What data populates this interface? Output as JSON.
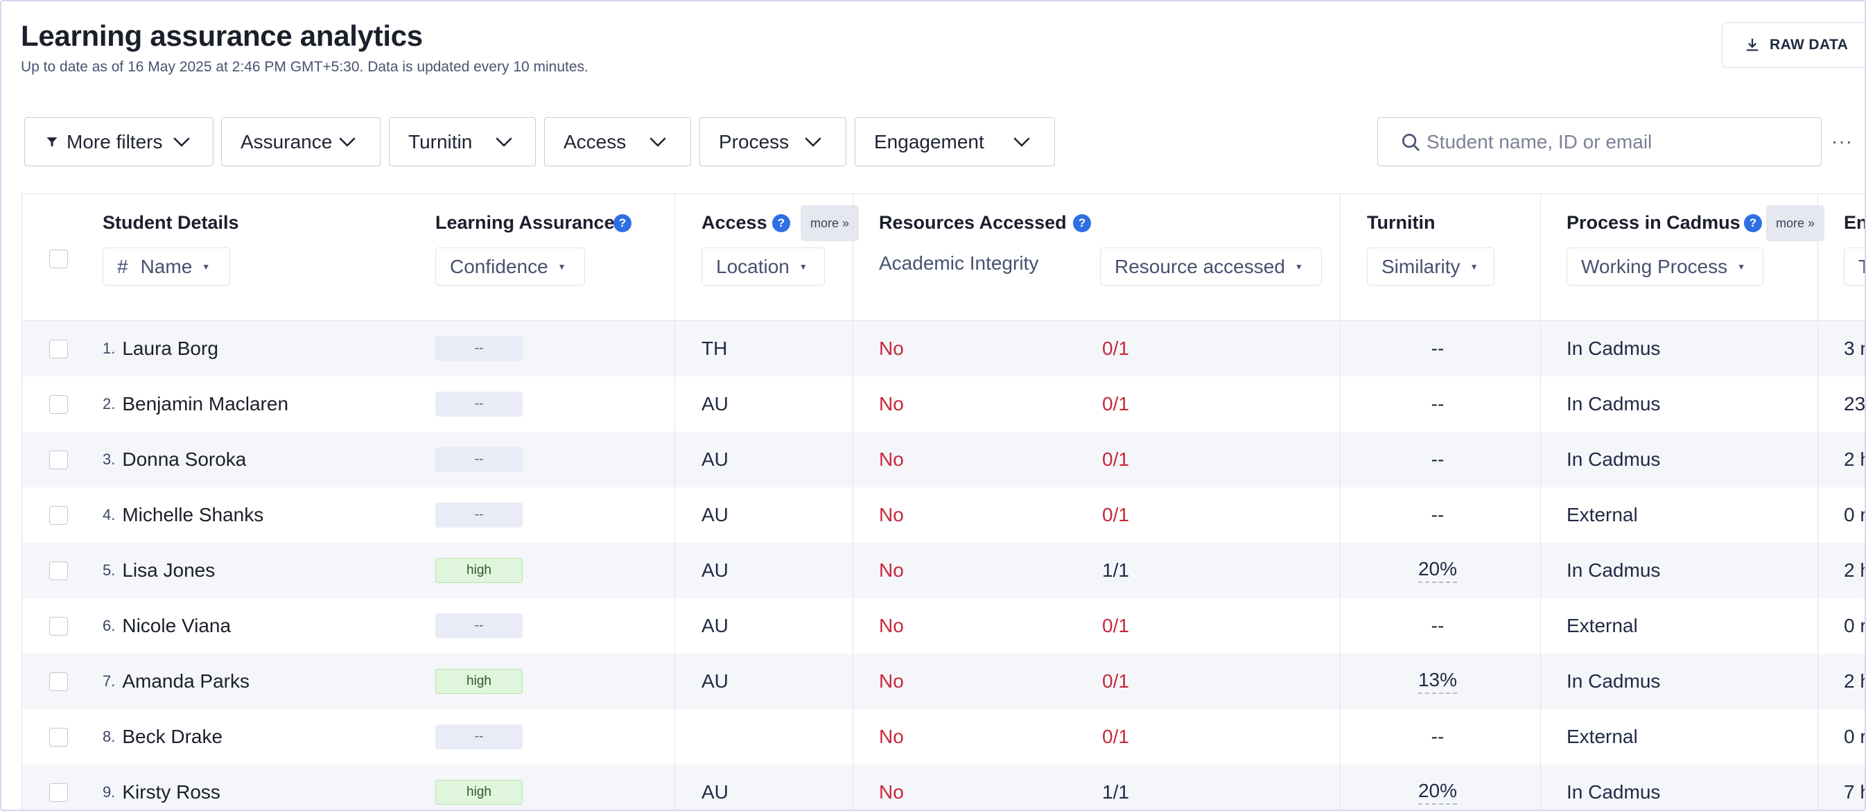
{
  "header": {
    "title": "Learning assurance analytics",
    "subtitle": "Up to date as of 16 May 2025 at 2:46 PM GMT+5:30. Data is updated every 10 minutes.",
    "raw_data_label": "RAW DATA"
  },
  "filters": {
    "more": "More filters",
    "assurance": "Assurance",
    "turnitin": "Turnitin",
    "access": "Access",
    "process": "Process",
    "engagement": "Engagement"
  },
  "search": {
    "placeholder": "Student name, ID or email",
    "value": ""
  },
  "more_menu": "···",
  "columns": {
    "student": {
      "title": "Student Details",
      "hash": "#",
      "sort": "Name"
    },
    "assurance": {
      "title": "Learning Assurance",
      "sort": "Confidence"
    },
    "access": {
      "title": "Access",
      "more": "more »",
      "sort": "Location"
    },
    "resources": {
      "title": "Resources Accessed",
      "sub": "Academic Integrity",
      "sort": "Resource accessed"
    },
    "turnitin": {
      "title": "Turnitin",
      "sort": "Similarity"
    },
    "process": {
      "title": "Process in Cadmus",
      "more": "more »",
      "sort": "Working Process"
    },
    "engagement": {
      "title": "En",
      "sort": "T"
    }
  },
  "help_glyph": "?",
  "rows": [
    {
      "num": "1.",
      "name": "Laura Borg",
      "confidence": "--",
      "confidence_level": "none",
      "location": "TH",
      "integrity": "No",
      "resource": "0/1",
      "similarity": "--",
      "process": "In Cadmus",
      "engagement": "3 r"
    },
    {
      "num": "2.",
      "name": "Benjamin Maclaren",
      "confidence": "--",
      "confidence_level": "none",
      "location": "AU",
      "integrity": "No",
      "resource": "0/1",
      "similarity": "--",
      "process": "In Cadmus",
      "engagement": "23"
    },
    {
      "num": "3.",
      "name": "Donna Soroka",
      "confidence": "--",
      "confidence_level": "none",
      "location": "AU",
      "integrity": "No",
      "resource": "0/1",
      "similarity": "--",
      "process": "In Cadmus",
      "engagement": "2 h"
    },
    {
      "num": "4.",
      "name": "Michelle Shanks",
      "confidence": "--",
      "confidence_level": "none",
      "location": "AU",
      "integrity": "No",
      "resource": "0/1",
      "similarity": "--",
      "process": "External",
      "engagement": "0 r"
    },
    {
      "num": "5.",
      "name": "Lisa Jones",
      "confidence": "high",
      "confidence_level": "high",
      "location": "AU",
      "integrity": "No",
      "resource": "1/1",
      "similarity": "20%",
      "process": "In Cadmus",
      "engagement": "2 h"
    },
    {
      "num": "6.",
      "name": "Nicole Viana",
      "confidence": "--",
      "confidence_level": "none",
      "location": "AU",
      "integrity": "No",
      "resource": "0/1",
      "similarity": "--",
      "process": "External",
      "engagement": "0 r"
    },
    {
      "num": "7.",
      "name": "Amanda Parks",
      "confidence": "high",
      "confidence_level": "high",
      "location": "AU",
      "integrity": "No",
      "resource": "0/1",
      "similarity": "13%",
      "process": "In Cadmus",
      "engagement": "2 h"
    },
    {
      "num": "8.",
      "name": "Beck Drake",
      "confidence": "--",
      "confidence_level": "none",
      "location": "",
      "integrity": "No",
      "resource": "0/1",
      "similarity": "--",
      "process": "External",
      "engagement": "0 r"
    },
    {
      "num": "9.",
      "name": "Kirsty Ross",
      "confidence": "high",
      "confidence_level": "high",
      "location": "AU",
      "integrity": "No",
      "resource": "1/1",
      "similarity": "20%",
      "process": "In Cadmus",
      "engagement": "7 h"
    }
  ]
}
